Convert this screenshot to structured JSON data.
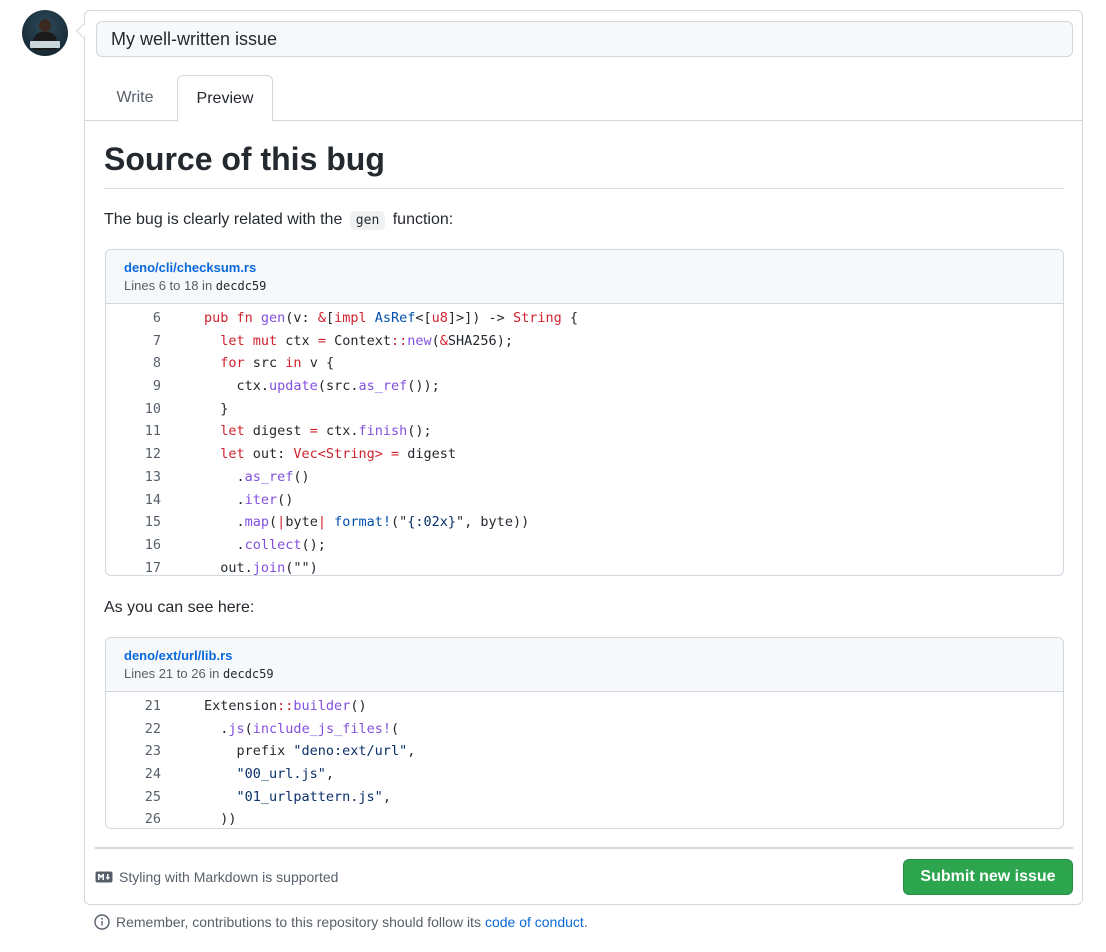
{
  "issue": {
    "title_value": "My well-written issue"
  },
  "tabs": [
    {
      "label": "Write"
    },
    {
      "label": "Preview"
    }
  ],
  "preview": {
    "heading": "Source of this bug",
    "para1_before": "The bug is clearly related with the ",
    "para1_code": "gen",
    "para1_after": " function:",
    "para2": "As you can see here:"
  },
  "snippets": [
    {
      "path": "deno/cli/checksum.rs",
      "lines_prefix": "Lines 6 to 18 in ",
      "sha": "decdc59",
      "lines": [
        {
          "n": "6",
          "tokens": [
            [
              "k",
              "pub fn "
            ],
            [
              "f",
              "gen"
            ],
            [
              "",
              "(v: "
            ],
            [
              "k",
              "&"
            ],
            [
              "",
              "["
            ],
            [
              "k",
              "impl "
            ],
            [
              "t",
              "AsRef"
            ],
            [
              "",
              "<["
            ],
            [
              "k",
              "u8"
            ],
            [
              "",
              "]>]) -> "
            ],
            [
              "k",
              "String"
            ],
            [
              "",
              " {"
            ]
          ]
        },
        {
          "n": "7",
          "tokens": [
            [
              "",
              "  "
            ],
            [
              "k",
              "let mut "
            ],
            [
              "",
              "ctx "
            ],
            [
              "k",
              "= "
            ],
            [
              "",
              "Context"
            ],
            [
              "k",
              "::"
            ],
            [
              "f",
              "new"
            ],
            [
              "",
              "("
            ],
            [
              "k",
              "&"
            ],
            [
              "",
              "SHA256);"
            ]
          ]
        },
        {
          "n": "8",
          "tokens": [
            [
              "",
              "  "
            ],
            [
              "k",
              "for "
            ],
            [
              "",
              "src "
            ],
            [
              "k",
              "in "
            ],
            [
              "",
              "v {"
            ]
          ]
        },
        {
          "n": "9",
          "tokens": [
            [
              "",
              "    ctx."
            ],
            [
              "f",
              "update"
            ],
            [
              "",
              "(src."
            ],
            [
              "f",
              "as_ref"
            ],
            [
              "",
              "());"
            ]
          ]
        },
        {
          "n": "10",
          "tokens": [
            [
              "",
              "  }"
            ]
          ]
        },
        {
          "n": "11",
          "tokens": [
            [
              "",
              "  "
            ],
            [
              "k",
              "let "
            ],
            [
              "",
              "digest "
            ],
            [
              "k",
              "= "
            ],
            [
              "",
              "ctx."
            ],
            [
              "f",
              "finish"
            ],
            [
              "",
              "();"
            ]
          ]
        },
        {
          "n": "12",
          "tokens": [
            [
              "",
              "  "
            ],
            [
              "k",
              "let "
            ],
            [
              "",
              "out: "
            ],
            [
              "k",
              "Vec<String> = "
            ],
            [
              "",
              "digest"
            ]
          ]
        },
        {
          "n": "13",
          "tokens": [
            [
              "",
              "    ."
            ],
            [
              "f",
              "as_ref"
            ],
            [
              "",
              "()"
            ]
          ]
        },
        {
          "n": "14",
          "tokens": [
            [
              "",
              "    ."
            ],
            [
              "f",
              "iter"
            ],
            [
              "",
              "()"
            ]
          ]
        },
        {
          "n": "15",
          "tokens": [
            [
              "",
              "    ."
            ],
            [
              "f",
              "map"
            ],
            [
              "",
              "("
            ],
            [
              "k",
              "|"
            ],
            [
              "",
              "byte"
            ],
            [
              "k",
              "| "
            ],
            [
              "t",
              "format!"
            ],
            [
              "",
              "(\""
            ],
            [
              "s",
              "{:02x}"
            ],
            [
              "",
              "\", byte))"
            ]
          ]
        },
        {
          "n": "16",
          "tokens": [
            [
              "",
              "    ."
            ],
            [
              "f",
              "collect"
            ],
            [
              "",
              "();"
            ]
          ]
        },
        {
          "n": "17",
          "tokens": [
            [
              "",
              "  out."
            ],
            [
              "f",
              "join"
            ],
            [
              "",
              "(\"\")"
            ]
          ]
        }
      ]
    },
    {
      "path": "deno/ext/url/lib.rs",
      "lines_prefix": "Lines 21 to 26 in ",
      "sha": "decdc59",
      "lines": [
        {
          "n": "21",
          "tokens": [
            [
              "",
              "Extension"
            ],
            [
              "k",
              "::"
            ],
            [
              "f",
              "builder"
            ],
            [
              "",
              "()"
            ]
          ]
        },
        {
          "n": "22",
          "tokens": [
            [
              "",
              "  ."
            ],
            [
              "f",
              "js"
            ],
            [
              "",
              "("
            ],
            [
              "f",
              "include_js_files!"
            ],
            [
              "",
              "("
            ]
          ]
        },
        {
          "n": "23",
          "tokens": [
            [
              "",
              "    prefix "
            ],
            [
              "s",
              "\"deno:ext/url\""
            ],
            [
              "",
              ","
            ]
          ]
        },
        {
          "n": "24",
          "tokens": [
            [
              "",
              "    "
            ],
            [
              "s",
              "\"00_url.js\""
            ],
            [
              "",
              ","
            ]
          ]
        },
        {
          "n": "25",
          "tokens": [
            [
              "",
              "    "
            ],
            [
              "s",
              "\"01_urlpattern.js\""
            ],
            [
              "",
              ","
            ]
          ]
        },
        {
          "n": "26",
          "tokens": [
            [
              "",
              "  ))"
            ]
          ]
        }
      ]
    }
  ],
  "footer": {
    "markdown_note": "Styling with Markdown is supported",
    "submit_label": "Submit new issue",
    "remember_text": "Remember, contributions to this repository should follow its",
    "coc_link": "code of conduct",
    "coc_period": "."
  },
  "colors": {
    "keyword": "#cf222e",
    "function": "#8250df",
    "type": "#0550ae",
    "string": "#0a3069",
    "submit_bg": "#2da44e",
    "link": "#0969da"
  },
  "icons": [
    "markdown-icon",
    "info-icon"
  ]
}
